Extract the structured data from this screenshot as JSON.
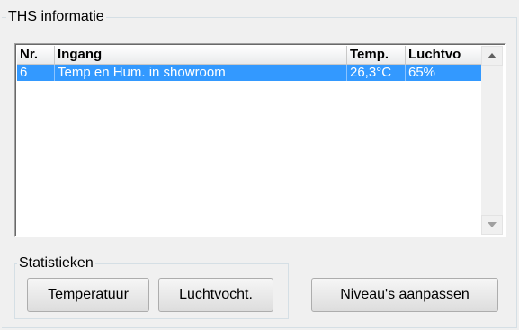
{
  "group": {
    "title": "THS informatie"
  },
  "table": {
    "columns": [
      "Nr.",
      "Ingang",
      "Temp.",
      "Luchtvo"
    ],
    "rows": [
      {
        "nr": "6",
        "ingang": "Temp en Hum. in showroom",
        "temp": "26,3°C",
        "luchtvocht": "65%",
        "selected": true
      }
    ]
  },
  "statistics": {
    "title": "Statistieken",
    "buttons": {
      "temperature": "Temperatuur",
      "humidity": "Luchtvocht."
    }
  },
  "actions": {
    "adjust_levels": "Niveau's aanpassen"
  },
  "colors": {
    "selection": "#3399ff",
    "background": "#f0f0f0"
  },
  "icons": {
    "scroll_up": "up-arrow-icon",
    "scroll_down": "down-arrow-icon"
  }
}
